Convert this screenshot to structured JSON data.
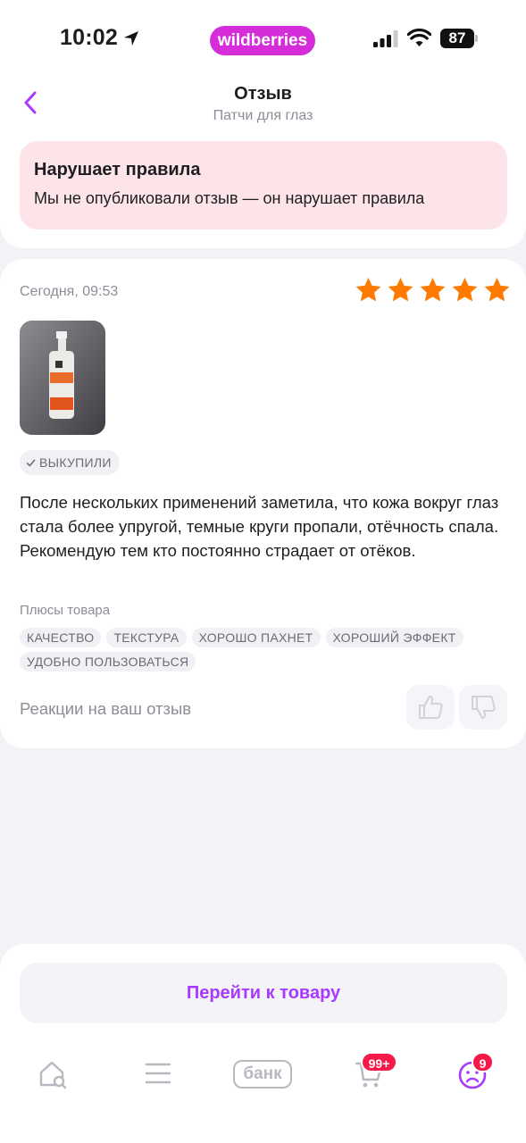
{
  "status_bar": {
    "time": "10:02",
    "brand": "wildberries",
    "battery": "87",
    "brand_color": "#d52dd9"
  },
  "header": {
    "title": "Отзыв",
    "subtitle": "Патчи для глаз",
    "back_icon": "chevron-left-icon"
  },
  "warning": {
    "title": "Нарушает правила",
    "text": "Мы не опубликовали отзыв — он нарушает правила"
  },
  "review": {
    "date": "Сегодня, 09:53",
    "rating": 5,
    "rating_max": 5,
    "star_color": "#ff7a00",
    "bought_badge": "ВЫКУПИЛИ",
    "text": "После нескольких применений заметила, что кожа вокруг глаз стала более упругой, темные круги пропали, отёчность спала. Рекомендую тем кто постоянно страдает от отёков.",
    "pros_label": "Плюсы товара",
    "pros": [
      "КАЧЕСТВО",
      "ТЕКСТУРА",
      "ХОРОШО ПАХНЕТ",
      "ХОРОШИЙ ЭФФЕКТ",
      "УДОБНО ПОЛЬЗОВАТЬСЯ"
    ],
    "reactions_label": "Реакции на ваш отзыв"
  },
  "bottom": {
    "goto_button": "Перейти к товару",
    "accent": "#a73afd",
    "tabs": {
      "home_icon": "home-search-icon",
      "catalog_icon": "menu-icon",
      "bank_label": "банк",
      "cart_badge": "99+",
      "profile_badge": "9"
    }
  }
}
